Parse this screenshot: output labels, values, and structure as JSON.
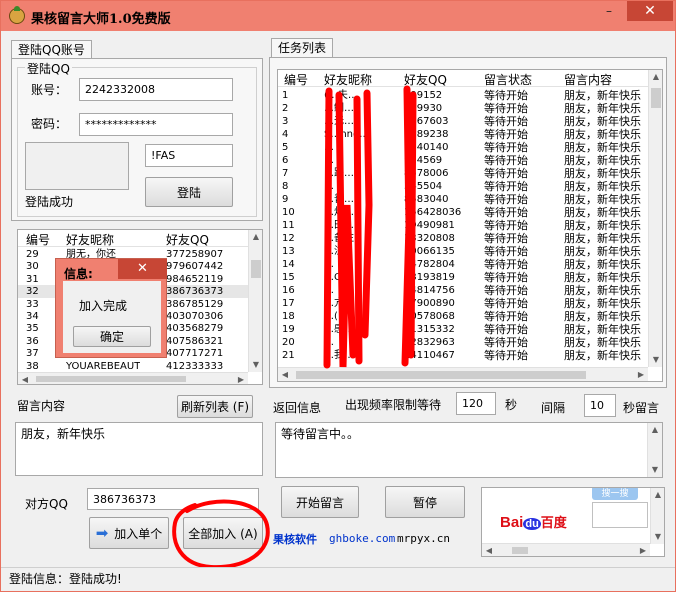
{
  "window": {
    "title": "果核留言大师1.0免费版",
    "minimize_glyph": "–",
    "maximize_glyph": "□",
    "close_glyph": "✕",
    "app_icon": "fruit-core-icon"
  },
  "login_tab": {
    "tab_label": "登陆QQ账号",
    "group_label": "登陆QQ",
    "account_label": "账号：",
    "account_value": "2242332008",
    "password_label": "密码：",
    "password_value": "*************",
    "captcha_value": "!FAS",
    "login_button": "登陆",
    "login_status": "登陆成功"
  },
  "friend_list": {
    "headers": [
      "编号",
      "好友昵称",
      "好友QQ"
    ],
    "rows": [
      [
        "29",
        "朋无，你还",
        "377258907"
      ],
      [
        "30",
        "",
        "979607442"
      ],
      [
        "31",
        "",
        "984652119"
      ],
      [
        "32",
        "",
        "386736373"
      ],
      [
        "33",
        "",
        "386785129"
      ],
      [
        "34",
        "",
        "403070306"
      ],
      [
        "35",
        "",
        "403568279"
      ],
      [
        "36",
        "",
        "407586321"
      ],
      [
        "37",
        "",
        "407717271"
      ],
      [
        "38",
        "YOUAREBEAUT",
        "412333333"
      ]
    ]
  },
  "dialog": {
    "title": "信息:",
    "close_glyph": "✕",
    "message": "加入完成",
    "ok_button": "确定"
  },
  "task_tab": {
    "tab_label": "任务列表",
    "headers": [
      "编号",
      "好友昵称",
      "好友QQ",
      "留言状态",
      "留言内容"
    ],
    "rows": [
      [
        "1",
        "(…夫…",
        "299152",
        "等待开始",
        "朋友，新年快乐"
      ],
      [
        "2",
        "…鲷…",
        "299930",
        "等待开始",
        "朋友，新年快乐"
      ],
      [
        "3",
        "…无…",
        "1767603",
        "等待开始",
        "朋友，新年快乐"
      ],
      [
        "4",
        "S…hne…",
        "8089238",
        "等待开始",
        "朋友，新年快乐"
      ],
      [
        "5",
        "…",
        "7940140",
        "等待开始",
        "朋友，新年快乐"
      ],
      [
        "6",
        "…",
        "914569",
        "等待开始",
        "朋友，新年快乐"
      ],
      [
        "7",
        "…路…",
        "8578006",
        "等待开始",
        "朋友，新年快乐"
      ],
      [
        "8",
        "…",
        "345504",
        "等待开始",
        "朋友，新年快乐"
      ],
      [
        "9",
        "…普…",
        "8583040",
        "等待开始",
        "朋友，新年快乐"
      ],
      [
        "10",
        "…灯…",
        "156428036",
        "等待开始",
        "朋友，新年快乐"
      ],
      [
        "11",
        "…田…",
        "19490981",
        "等待开始",
        "朋友，新年快乐"
      ],
      [
        "12",
        "…备注)",
        "13320808",
        "等待开始",
        "朋友，新年快乐"
      ],
      [
        "13",
        "…注)",
        "10066135",
        "等待开始",
        "朋友，新年快乐"
      ],
      [
        "14",
        "…",
        "14782804",
        "等待开始",
        "朋友，新年快乐"
      ],
      [
        "15",
        "…Q…",
        "13193819",
        "等待开始",
        "朋友，新年快乐"
      ],
      [
        "16",
        "…",
        "14814756",
        "等待开始",
        "朋友，新年快乐"
      ],
      [
        "17",
        "…亢…",
        "17900890",
        "等待开始",
        "朋友，新年快乐"
      ],
      [
        "18",
        "…(…",
        "10578068",
        "等待开始",
        "朋友，新年快乐"
      ],
      [
        "19",
        "…感…",
        "11315332",
        "等待开始",
        "朋友，新年快乐"
      ],
      [
        "20",
        "…",
        "12832963",
        "等待开始",
        "朋友，新年快乐"
      ],
      [
        "21",
        "…我…",
        "14110467",
        "等待开始",
        "朋友，新年快乐"
      ]
    ]
  },
  "message_area": {
    "label": "留言内容",
    "refresh_button": "刷新列表 (F)",
    "content": "朋友，新年快乐"
  },
  "feedback_area": {
    "label": "返回信息",
    "content": "等待留言中。。"
  },
  "rate": {
    "label": "出现频率限制等待",
    "value": "120",
    "unit": "秒",
    "interval_label": "间隔",
    "interval_value": "10",
    "interval_unit": "秒留言"
  },
  "target": {
    "label": "对方QQ",
    "value": "386736373",
    "add_single_button": "加入单个",
    "add_all_button": "全部加入 (A)",
    "start_button": "开始留言",
    "pause_button": "暂停"
  },
  "branding": {
    "name": "果核软件",
    "site1": "ghboke.com",
    "site2": "mrpyx.cn",
    "ad_logo": "Bai",
    "ad_logo_du": "du",
    "ad_logo_cn": "百度",
    "ad_tab": "搜一搜"
  },
  "status": {
    "text": "登陆信息：登陆成功!"
  },
  "colors": {
    "title_bar": "#f08070",
    "close_button": "#c74635",
    "annotation_red": "#ff0000",
    "link_blue": "#0033cc",
    "baidu_red": "#de0f17",
    "baidu_blue": "#2932e1"
  }
}
